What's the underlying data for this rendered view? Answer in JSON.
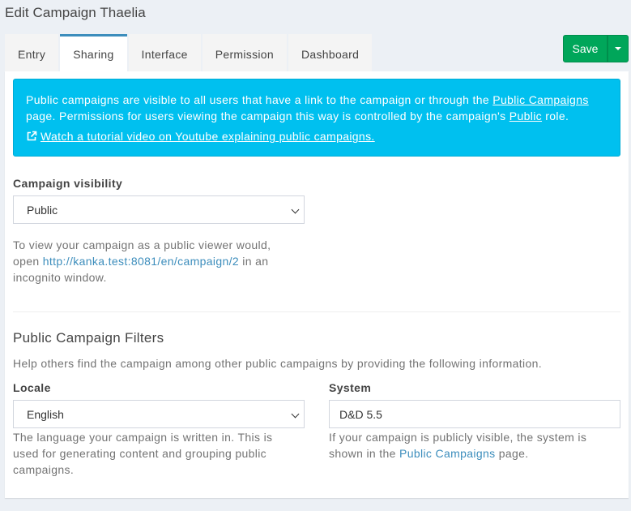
{
  "page": {
    "title": "Edit Campaign Thaelia"
  },
  "tabs": [
    {
      "label": "Entry"
    },
    {
      "label": "Sharing"
    },
    {
      "label": "Interface"
    },
    {
      "label": "Permission"
    },
    {
      "label": "Dashboard"
    }
  ],
  "toolbar": {
    "save_label": "Save"
  },
  "callout": {
    "line1_before": "Public campaigns are visible to all users that have a link to the campaign or through the ",
    "line1_link": "Public Campaigns",
    "line2_before": "page. Permissions for users viewing the campaign this way is controlled by the campaign's ",
    "line2_link": "Public",
    "line2_after": " role.",
    "tutorial_link": "Watch a tutorial video on Youtube explaining public campaigns."
  },
  "visibility": {
    "label": "Campaign visibility",
    "selected": "Public",
    "help_line1": "To view your campaign as a public viewer would,",
    "help_open": "open ",
    "help_url": "http://kanka.test:8081/en/campaign/2",
    "help_after": " in an",
    "help_line3": "incognito window."
  },
  "filters": {
    "title": "Public Campaign Filters",
    "description": "Help others find the campaign among other public campaigns by providing the following information.",
    "locale": {
      "label": "Locale",
      "selected": "English",
      "help_line1": "The language your campaign is written in. This is",
      "help_line2": "used for generating content and grouping public",
      "help_line3": "campaigns."
    },
    "system": {
      "label": "System",
      "value": "D&D 5.5",
      "help_line1": "If your campaign is publicly visible, the system is",
      "help_before": "shown in the ",
      "help_link": "Public Campaigns",
      "help_after": " page."
    }
  },
  "colors": {
    "info": "#00c0ef",
    "success": "#00a65a",
    "primary": "#3c8dbc",
    "background": "#ecf0f5"
  },
  "icons": {
    "external_link": "external-link-icon",
    "caret": "caret-down-icon",
    "chevron": "chevron-down-icon"
  }
}
